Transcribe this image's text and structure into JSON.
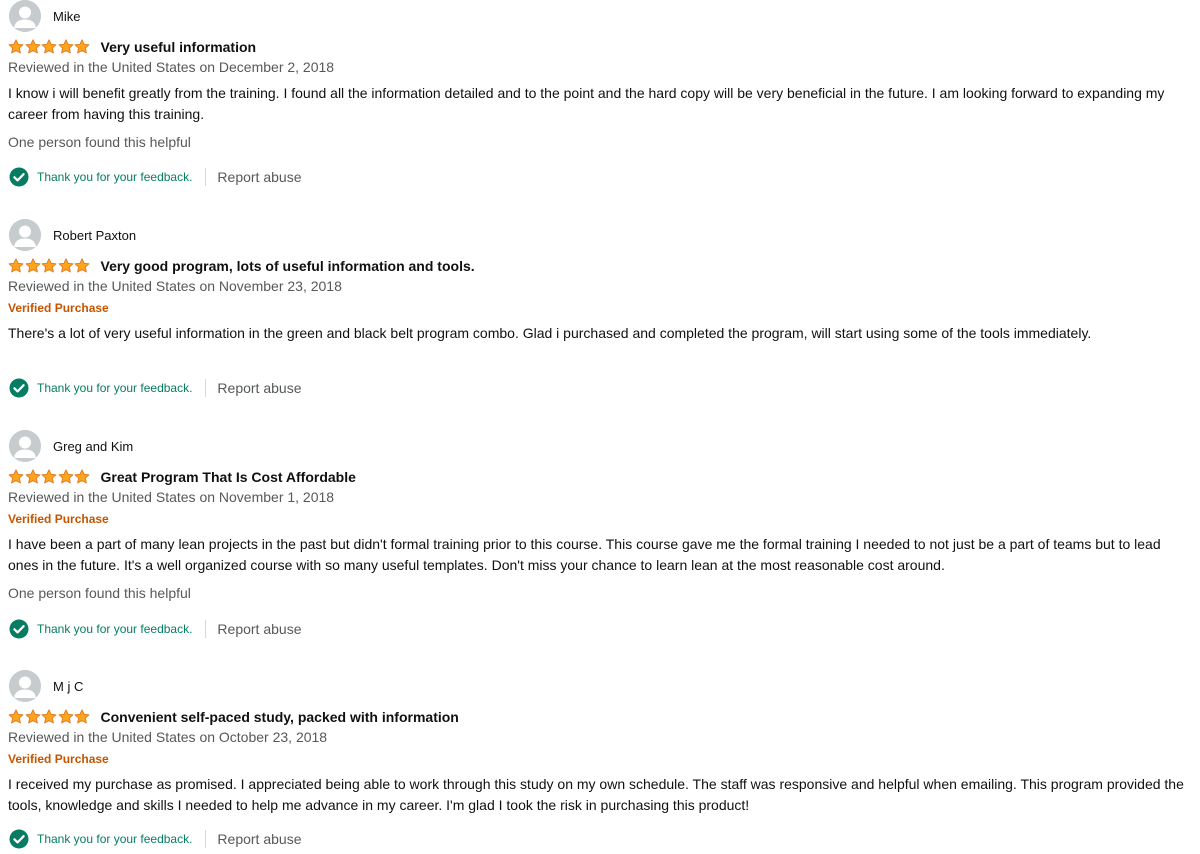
{
  "reviews": [
    {
      "name": "Mike",
      "rating": 5,
      "title": "Very useful information",
      "date": "Reviewed in the United States on December 2, 2018",
      "verified": "",
      "body": "I know i will benefit greatly from the training. I found all the information detailed and to the point and the hard copy will be very beneficial in the future. I am looking forward to expanding my career from having this training.",
      "helpful": "One person found this helpful",
      "feedback": "Thank you for your feedback.",
      "report": "Report abuse"
    },
    {
      "name": "Robert Paxton",
      "rating": 5,
      "title": "Very good program, lots of useful information and tools.",
      "date": "Reviewed in the United States on November 23, 2018",
      "verified": "Verified Purchase",
      "body": "There's a lot of very useful information in the green and black belt program combo. Glad i purchased and completed the program, will start using some of the tools immediately.",
      "helpful": "",
      "feedback": "Thank you for your feedback.",
      "report": "Report abuse"
    },
    {
      "name": "Greg and Kim",
      "rating": 5,
      "title": "Great Program That Is Cost Affordable",
      "date": "Reviewed in the United States on November 1, 2018",
      "verified": "Verified Purchase",
      "body": "I have been a part of many lean projects in the past but didn't formal training prior to this course. This course gave me the formal training I needed to not just be a part of teams but to lead ones in the future. It's a well organized course with so many useful templates. Don't miss your chance to learn lean at the most reasonable cost around.",
      "helpful": "One person found this helpful",
      "feedback": "Thank you for your feedback.",
      "report": "Report abuse"
    },
    {
      "name": "M j C",
      "rating": 5,
      "title": "Convenient self-paced study, packed with information",
      "date": "Reviewed in the United States on October 23, 2018",
      "verified": "Verified Purchase",
      "body": "I received my purchase as promised. I appreciated being able to work through this study on my own schedule. The staff was responsive and helpful when emailing. This program provided the tools, knowledge and skills I needed to help me advance in my career. I'm glad I took the risk in purchasing this product!",
      "helpful": "",
      "feedback": "Thank you for your feedback.",
      "report": "Report abuse"
    }
  ],
  "colors": {
    "star": "#ffa41c",
    "star_outline": "#de7921",
    "verified": "#c45500",
    "feedback": "#067d62",
    "muted": "#565959"
  },
  "icons": {
    "avatar": "default-avatar-icon",
    "star": "star-icon",
    "check": "check-circle-icon"
  }
}
